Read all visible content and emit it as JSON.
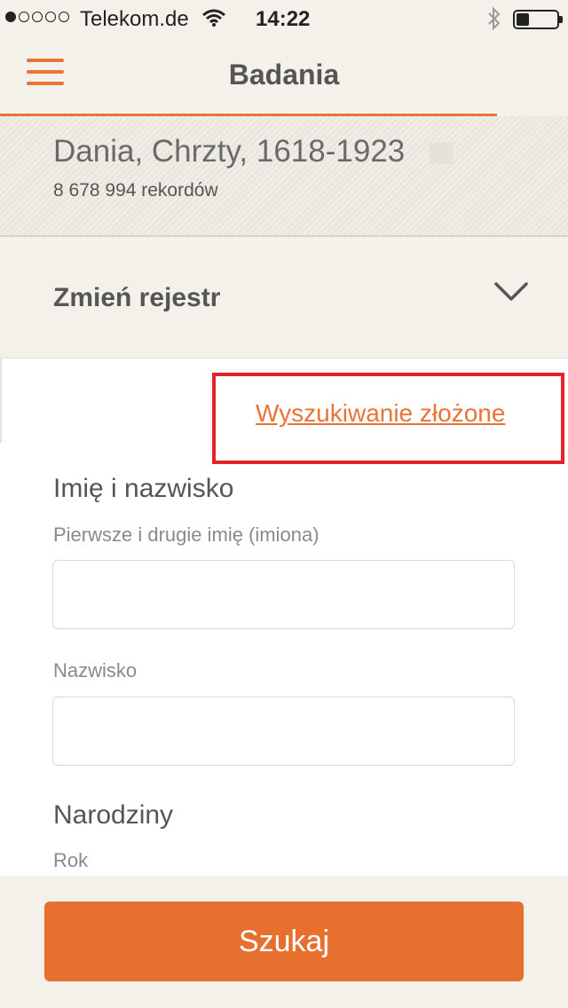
{
  "status_bar": {
    "carrier": "Telekom.de",
    "time": "14:22",
    "signal_filled": 1,
    "signal_total": 5,
    "battery_level": 0.3,
    "icons": [
      "wifi-icon",
      "bluetooth-icon",
      "battery-icon"
    ]
  },
  "nav": {
    "title": "Badania",
    "menu_icon": "hamburger-menu-icon"
  },
  "collection": {
    "title": "Dania, Chrzty, 1618-1923",
    "record_count": "8 678 994 rekordów"
  },
  "change_register": {
    "label": "Zmień rejestr",
    "icon": "chevron-down-icon"
  },
  "form": {
    "advanced_search_link": "Wyszukiwanie złożone",
    "name_section": "Imię i nazwisko",
    "first_name_label": "Pierwsze i drugie imię (imiona)",
    "first_name_value": "",
    "last_name_label": "Nazwisko",
    "last_name_value": "",
    "birth_section": "Narodziny",
    "year_label": "Rok"
  },
  "search_button": "Szukaj",
  "colors": {
    "accent": "#e8743a",
    "button": "#e8702f",
    "highlight_box": "#e3242b",
    "background": "#f4f1ea"
  }
}
